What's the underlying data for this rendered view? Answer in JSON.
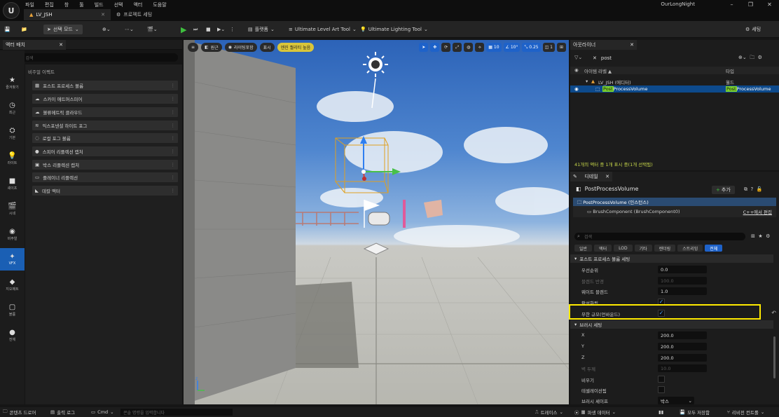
{
  "titlebar": {
    "logo": "U",
    "menus": [
      "파일",
      "편집",
      "창",
      "툴",
      "빌드",
      "선택",
      "액터",
      "도움말"
    ],
    "tabs": [
      {
        "label": "LV_JSH",
        "icon": "level-icon"
      },
      {
        "label": "프로젝트 세팅",
        "icon": "gear-icon"
      }
    ],
    "app_name": "OurLongNight",
    "win": {
      "min": "–",
      "max": "❐",
      "close": "✕"
    }
  },
  "toolbar": {
    "mode": "선택 모드",
    "platforms": "플랫폼",
    "ult_art": "Ultimate Level Art Tool",
    "ult_light": "Ultimate Lighting Tool",
    "settings": "세팅"
  },
  "left": {
    "tab": "액터 배치",
    "search_placeholder": "클래스 검색",
    "categories": [
      {
        "label": "즐겨찾기",
        "glyph": "★"
      },
      {
        "label": "최근",
        "glyph": "◷"
      },
      {
        "label": "기본",
        "glyph": "⛭"
      },
      {
        "label": "라이트",
        "glyph": "💡"
      },
      {
        "label": "셰이프",
        "glyph": "■"
      },
      {
        "label": "시네",
        "glyph": "🎬"
      },
      {
        "label": "비주얼",
        "glyph": "◉"
      },
      {
        "label": "VFX",
        "glyph": "✦"
      },
      {
        "label": "지오메트",
        "glyph": "◆"
      },
      {
        "label": "볼륨",
        "glyph": "▢"
      },
      {
        "label": "전체",
        "glyph": "●"
      }
    ],
    "active_category": "VFX",
    "list_title": "비주얼 이펙트",
    "items": [
      {
        "label": "포스트 프로세스 볼륨",
        "icon": "postprocess-icon"
      },
      {
        "label": "스카이 애트머스피어",
        "icon": "sky-icon"
      },
      {
        "label": "볼류메트릭 클라우드",
        "icon": "cloud-icon"
      },
      {
        "label": "익스포넨셜 하이트 포그",
        "icon": "fog-icon"
      },
      {
        "label": "로컬 포그 볼륨",
        "icon": "fog-volume-icon"
      },
      {
        "label": "스피어 리플렉션 캡처",
        "icon": "sphere-icon"
      },
      {
        "label": "박스 리플렉션 캡처",
        "icon": "box-icon"
      },
      {
        "label": "플레이너 리플렉션",
        "icon": "planar-icon"
      },
      {
        "label": "데칼 액터",
        "icon": "decal-icon"
      }
    ]
  },
  "viewport": {
    "menu": "≡",
    "perspective": "원근",
    "lit": "라이팅포함",
    "show": "표시",
    "warning": "엔진 퀄리티 높음",
    "grid": "10",
    "angle": "10°",
    "scale": "0.25",
    "cams": "1"
  },
  "outliner": {
    "tab": "아웃라이너",
    "search_value": "post",
    "col_label": "아이템 라벨 ▲",
    "col_type": "타입",
    "rows": [
      {
        "label": "LV_JSH (에디터)",
        "type": "월드"
      },
      {
        "label_hl": "Post",
        "label_rest": "ProcessVolume",
        "type_hl": "Post",
        "type_rest": "ProcessVolume"
      }
    ],
    "status": "41개의 액터 중 1개 표시 중(1개 선택됨)"
  },
  "details": {
    "tab": "디테일",
    "title": "PostProcessVolume",
    "add": "추가",
    "root": "PostProcessVolume (인스턴스)",
    "child": "BrushComponent (BrushComponent0)",
    "edit_cpp": "C++에서 편집",
    "search_placeholder": "검색",
    "filters": [
      "일반",
      "액터",
      "LOD",
      "기타",
      "렌더링",
      "스트리밍",
      "전체"
    ],
    "active_filter": "전체",
    "sec1": "포스트 프로세스 볼륨 세팅",
    "props1": [
      {
        "label": "우선순위",
        "value": "0.0"
      },
      {
        "label": "블렌드 반경",
        "value": "100.0"
      },
      {
        "label": "웨이트 블렌드",
        "value": "1.0"
      }
    ],
    "enabled_label": "활성화됨",
    "infinite_label": "무한 규모(언바운드)",
    "sec2": "브러시 세팅",
    "brush": [
      {
        "label": "X",
        "value": "200.0"
      },
      {
        "label": "Y",
        "value": "200.0"
      },
      {
        "label": "Z",
        "value": "200.0"
      },
      {
        "label": "벽 두께",
        "value": "10.0"
      }
    ],
    "hollow_label": "비우기",
    "tess_label": "테셀레이션됨",
    "shape_label": "브러시 셰이프",
    "shape_value": "박스"
  },
  "statusbar": {
    "content_drawer": "콘텐츠 드로어",
    "output_log": "출력 로그",
    "cmd": "Cmd",
    "cmd_placeholder": "콘솔 명령을 입력합니다",
    "trace": "트레이스",
    "derived": "파생 데이터",
    "save_all": "모두 저장함",
    "revision": "리비전 컨트롤"
  }
}
